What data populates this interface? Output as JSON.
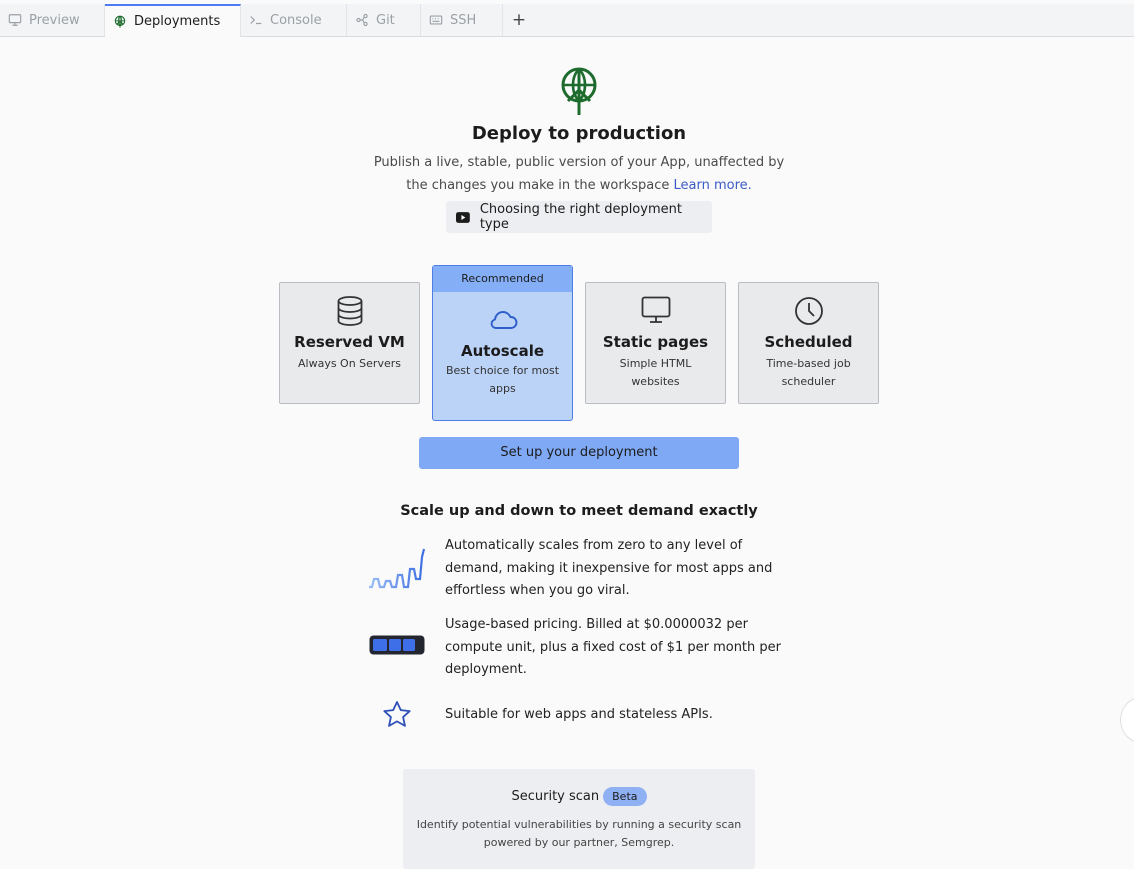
{
  "tabs": [
    {
      "label": "Preview",
      "icon": "monitor-icon"
    },
    {
      "label": "Deployments",
      "icon": "deploy-globe-icon",
      "active": true
    },
    {
      "label": "Console",
      "icon": "terminal-icon"
    },
    {
      "label": "Git",
      "icon": "git-branch-icon"
    },
    {
      "label": "SSH",
      "icon": "keyboard-icon"
    }
  ],
  "tab_add": "+",
  "header": {
    "title": "Deploy to production",
    "subtitle_part1": "Publish a live, stable, public version of your App, unaffected by the changes you make in the workspace ",
    "learn_more": "Learn more.",
    "video_label": "Choosing the right deployment type"
  },
  "cards": {
    "reserved": {
      "name": "Reserved VM",
      "desc": "Always On Servers"
    },
    "autoscale": {
      "badge": "Recommended",
      "name": "Autoscale",
      "desc": "Best choice for most apps"
    },
    "static": {
      "name": "Static pages",
      "desc": "Simple HTML websites"
    },
    "scheduled": {
      "name": "Scheduled",
      "desc": "Time-based job scheduler"
    }
  },
  "setup_button": "Set up your deployment",
  "section_heading": "Scale up and down to meet demand exactly",
  "features": [
    "Automatically scales from zero to any level of demand, making it inexpensive for most apps and effortless when you go viral.",
    "Usage-based pricing. Billed at $0.0000032 per compute unit, plus a fixed cost of $1 per month per deployment.",
    "Suitable for web apps and stateless APIs."
  ],
  "security": {
    "title": "Security scan",
    "badge": "Beta",
    "desc": "Identify potential vulnerabilities by running a security scan powered by our partner, Semgrep."
  },
  "colors": {
    "accent": "#4d7ee8",
    "selected_card": "#bcd3f8",
    "button": "#7fa9f5",
    "logo_green": "#1e6b2e"
  }
}
